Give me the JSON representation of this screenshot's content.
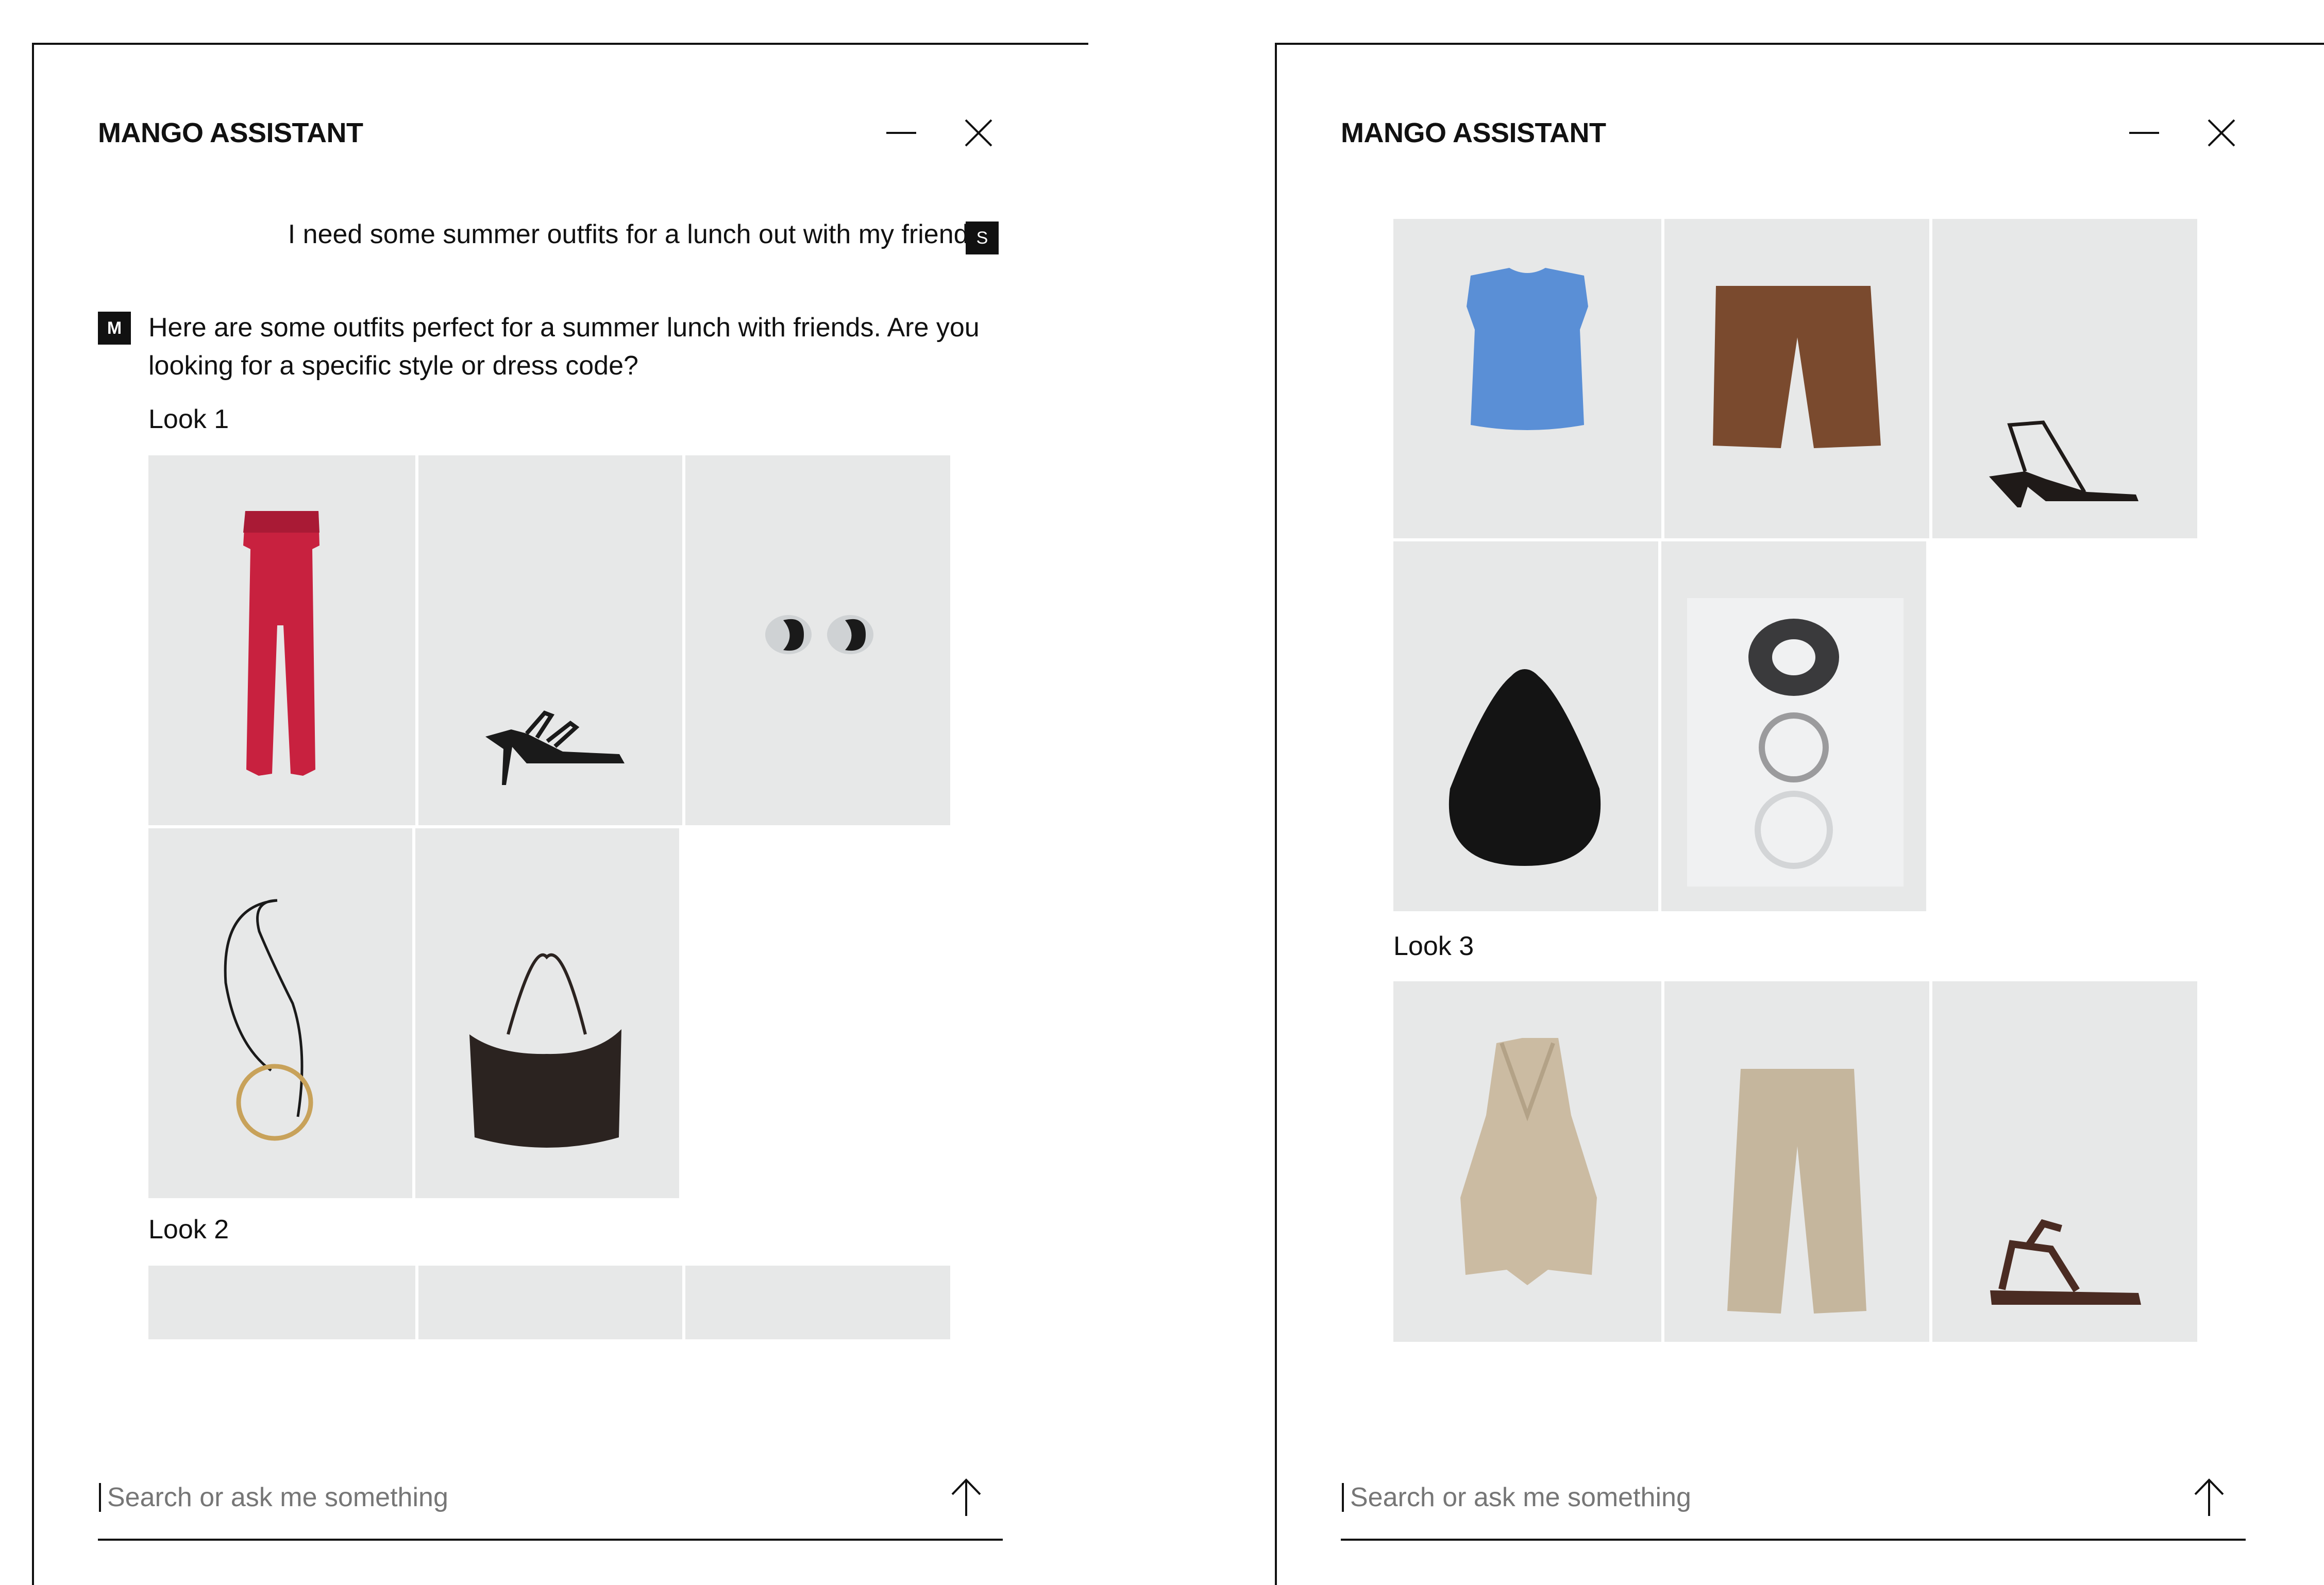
{
  "left_panel": {
    "title": "MANGO ASSISTANT",
    "user_message": "I need some summer outfits for a lunch out with my friend.",
    "user_avatar": "S",
    "bot_avatar": "M",
    "bot_message": "Here are some outfits perfect for a summer lunch with friends. Are you looking for a specific style or dress code?",
    "look_1_label": "Look 1",
    "look_2_label": "Look 2",
    "search_placeholder": "Search or ask me something"
  },
  "right_panel": {
    "title": "MANGO ASSISTANT",
    "look_3_label": "Look 3",
    "search_placeholder": "Search or ask me something"
  },
  "icons": {
    "minimize": "minimize-icon",
    "close": "close-icon",
    "send": "arrow-up-icon"
  },
  "products": {
    "look_1": [
      "red strapless jumpsuit",
      "black strappy heeled sandal",
      "silver hoop earrings",
      "cord necklace with gold ring pendant",
      "dark brown shoulder bag"
    ],
    "look_2": [
      "blue sleeveless top",
      "brown bermuda shorts",
      "black kitten-heel sandal",
      "black woven shoulder bag",
      "set of bangles"
    ],
    "look_3": [
      "beige halter waistcoat",
      "beige wide trousers",
      "brown flat sandal"
    ]
  },
  "colors": {
    "text": "#111111",
    "tile_bg": "#e7e8e8",
    "placeholder": "#767676"
  }
}
